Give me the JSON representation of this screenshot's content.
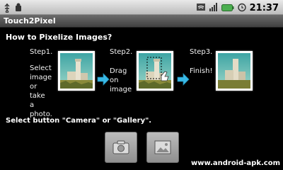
{
  "status_bar": {
    "time": "21:37",
    "icons": [
      "usb-icon",
      "android-debug-icon",
      "wifi-icon",
      "signal-icon",
      "battery-icon",
      "alarm-clock-icon"
    ]
  },
  "app": {
    "title": "Touch2Pixel"
  },
  "instructions": {
    "heading": "How to Pixelize Images?",
    "steps": [
      {
        "label": "Step1.",
        "desc": [
          "Select",
          "image",
          "or",
          "take",
          "a",
          "photo."
        ]
      },
      {
        "label": "Step2.",
        "desc": [
          "Drag",
          "on",
          "image"
        ]
      },
      {
        "label": "Step3.",
        "desc": [
          "Finish!"
        ]
      }
    ],
    "select_prompt": "Select button \"Camera\" or \"Gallery\"."
  },
  "buttons": {
    "camera": "camera-icon",
    "gallery": "gallery-icon"
  },
  "watermark": "www.android-apk.com",
  "colors": {
    "arrow": "#39b9e6",
    "titlebar": "#555555",
    "status_bar": "#d0d0d0"
  }
}
